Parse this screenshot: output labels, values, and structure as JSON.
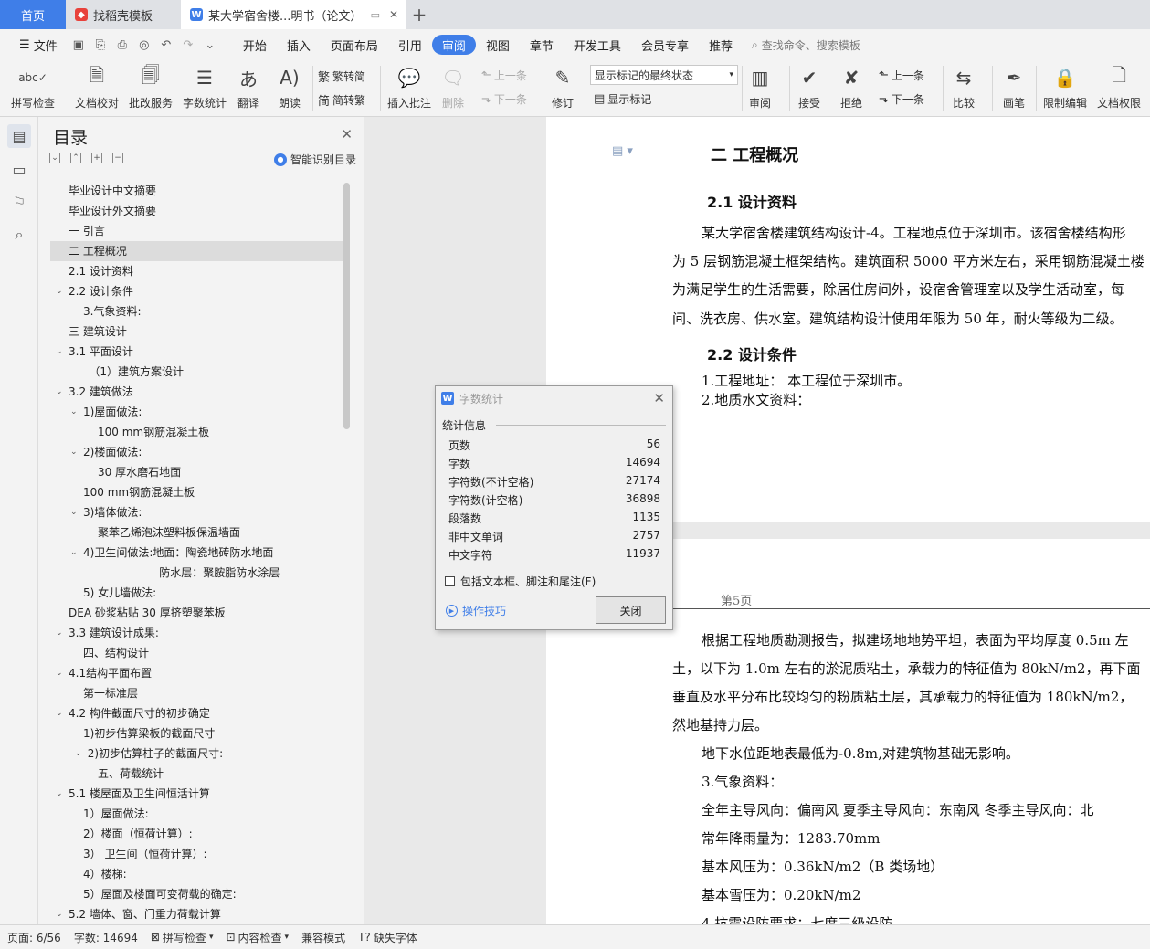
{
  "tabs": {
    "home": "首页",
    "template": "找稻壳模板",
    "doc": "某大学宿舍楼...明书（论文）"
  },
  "menu": {
    "file": "文件",
    "items": [
      "开始",
      "插入",
      "页面布局",
      "引用",
      "审阅",
      "视图",
      "章节",
      "开发工具",
      "会员专享",
      "推荐"
    ],
    "active": "审阅",
    "search": "查找命令、搜索模板"
  },
  "ribbon": {
    "spell": "拼写检查",
    "proof": "文档校对",
    "batch": "批改服务",
    "wordcount": "字数统计",
    "translate": "翻译",
    "read": "朗读",
    "trad": "繁转简",
    "simp": "简转繁",
    "insert_comment": "插入批注",
    "delete": "删除",
    "prev": "上一条",
    "next": "下一条",
    "revise": "修订",
    "markup_select": "显示标记的最终状态",
    "show_markup": "显示标记",
    "review": "审阅",
    "accept": "接受",
    "reject": "拒绝",
    "prev2": "上一条",
    "next2": "下一条",
    "compare": "比较",
    "pen": "画笔",
    "restrict": "限制编辑",
    "rights": "文档权限"
  },
  "toc": {
    "title": "目录",
    "smart": "智能识别目录",
    "items": [
      {
        "t": "毕业设计中文摘要",
        "i": 0,
        "a": ""
      },
      {
        "t": "毕业设计外文摘要",
        "i": 0,
        "a": ""
      },
      {
        "t": "一  引言",
        "i": 0,
        "a": ""
      },
      {
        "t": "二 工程概况",
        "i": 0,
        "a": "",
        "sel": true
      },
      {
        "t": "2.1  设计资料",
        "i": 0,
        "a": ""
      },
      {
        "t": "2.2 设计条件",
        "i": 0,
        "a": "v"
      },
      {
        "t": "3.气象资料:",
        "i": 1,
        "a": ""
      },
      {
        "t": "三  建筑设计",
        "i": 0,
        "a": ""
      },
      {
        "t": "3.1  平面设计",
        "i": 0,
        "a": "v"
      },
      {
        "t": "（1）建筑方案设计",
        "i": 1.4,
        "a": ""
      },
      {
        "t": "3.2 建筑做法",
        "i": 0,
        "a": "v"
      },
      {
        "t": "1)屋面做法:",
        "i": 1,
        "a": "v"
      },
      {
        "t": "100 mm钢筋混凝土板",
        "i": 2,
        "a": ""
      },
      {
        "t": "2)楼面做法:",
        "i": 1,
        "a": "v"
      },
      {
        "t": "30 厚水磨石地面",
        "i": 2,
        "a": ""
      },
      {
        "t": "100 mm钢筋混凝土板",
        "i": 1,
        "a": ""
      },
      {
        "t": "3)墙体做法:",
        "i": 1,
        "a": "v"
      },
      {
        "t": "聚苯乙烯泡沫塑料板保温墙面",
        "i": 2,
        "a": ""
      },
      {
        "t": "4)卫生间做法:地面：陶瓷地砖防水地面",
        "i": 1,
        "a": "v"
      },
      {
        "t": "防水层：聚胺脂防水涂层",
        "i": 6.2,
        "a": ""
      },
      {
        "t": "5)  女儿墙做法:",
        "i": 1,
        "a": ""
      },
      {
        "t": "DEA 砂浆粘贴 30 厚挤塑聚苯板",
        "i": 0,
        "a": ""
      },
      {
        "t": "3.3  建筑设计成果:",
        "i": 0,
        "a": "v"
      },
      {
        "t": "四、结构设计",
        "i": 1,
        "a": ""
      },
      {
        "t": "4.1结构平面布置",
        "i": 0,
        "a": "v"
      },
      {
        "t": "第一标准层",
        "i": 1,
        "a": ""
      },
      {
        "t": "4.2 构件截面尺寸的初步确定",
        "i": 0,
        "a": "v"
      },
      {
        "t": "1)初步估算梁板的截面尺寸",
        "i": 1,
        "a": ""
      },
      {
        "t": "2)初步估算柱子的截面尺寸:",
        "i": 1.3,
        "a": "v"
      },
      {
        "t": "五、荷载统计",
        "i": 2,
        "a": ""
      },
      {
        "t": "5.1 楼屋面及卫生间恒活计算",
        "i": 0,
        "a": "v"
      },
      {
        "t": "1）屋面做法:",
        "i": 1,
        "a": ""
      },
      {
        "t": "2）楼面（恒荷计算）:",
        "i": 1,
        "a": ""
      },
      {
        "t": "3）  卫生间（恒荷计算）:",
        "i": 1,
        "a": ""
      },
      {
        "t": "4）楼梯:",
        "i": 1,
        "a": ""
      },
      {
        "t": "5）屋面及楼面可变荷载的确定:",
        "i": 1,
        "a": ""
      },
      {
        "t": "5.2 墙体、窗、门重力荷载计算",
        "i": 0,
        "a": "v"
      }
    ]
  },
  "doc": {
    "h1": "二  工程概况",
    "h21": "2.1  设计资料",
    "p1": [
      "某大学宿舍楼建筑结构设计-4。工程地点位于深圳市。该宿舍楼结构形",
      "为 5 层钢筋混凝土框架结构。建筑面积 5000 平方米左右，采用钢筋混凝土楼",
      "为满足学生的生活需要，除居住房间外，设宿舍管理室以及学生活动室，每",
      "间、洗衣房、供水室。建筑结构设计使用年限为 50 年，耐火等级为二级。"
    ],
    "h22": "2.2 设计条件",
    "l1": "1.工程地址：  本工程位于深圳市。",
    "l2": "2.地质水文资料：",
    "pagenum": "第5页",
    "p2": [
      "根据工程地质勘测报告，拟建场地地势平坦，表面为平均厚度 0.5m 左",
      "土，以下为 1.0m 左右的淤泥质粘土，承载力的特征值为 80kN/m2，再下面",
      "垂直及水平分布比较均匀的粉质粘土层，其承载力的特征值为 180kN/m2，",
      "然地基持力层。"
    ],
    "p3": "地下水位距地表最低为-0.8m,对建筑物基础无影响。",
    "p4": "3.气象资料：",
    "p5": "全年主导风向：偏南风    夏季主导风向：东南风    冬季主导风向：北",
    "p6": "常年降雨量为：1283.70mm",
    "p7": "基本风压为：0.36kN/m2（B 类场地）",
    "p8": "基本雪压为：0.20kN/m2",
    "p9": "4.抗震设防要求：七度三级设防"
  },
  "dialog": {
    "title": "字数统计",
    "group": "统计信息",
    "rows": [
      {
        "k": "页数",
        "v": "56"
      },
      {
        "k": "字数",
        "v": "14694"
      },
      {
        "k": "字符数(不计空格)",
        "v": "27174"
      },
      {
        "k": "字符数(计空格)",
        "v": "36898"
      },
      {
        "k": "段落数",
        "v": "1135"
      },
      {
        "k": "非中文单词",
        "v": "2757"
      },
      {
        "k": "中文字符",
        "v": "11937"
      }
    ],
    "checkbox": "包括文本框、脚注和尾注(F)",
    "tips": "操作技巧",
    "close": "关闭"
  },
  "status": {
    "page": "页面: 6/56",
    "words": "字数: 14694",
    "spell": "拼写检查",
    "content": "内容检查",
    "compat": "兼容模式",
    "font": "缺失字体"
  }
}
